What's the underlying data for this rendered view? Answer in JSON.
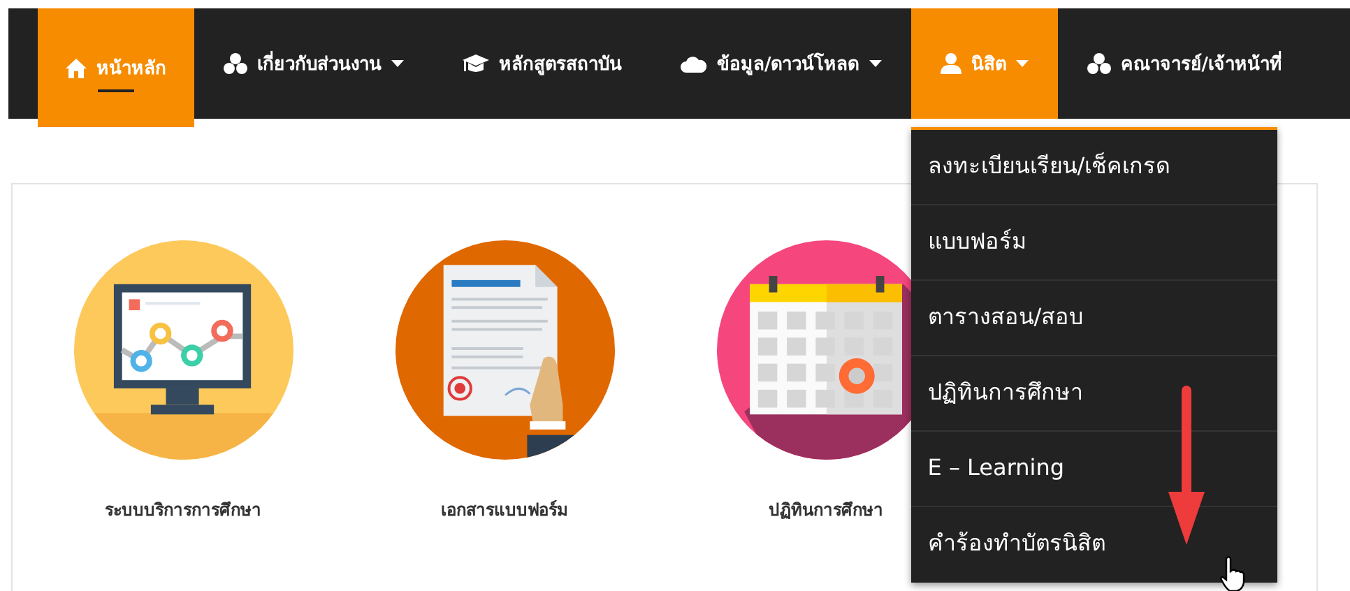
{
  "navbar": {
    "items": [
      {
        "label": "หน้าหลัก",
        "kind": "home",
        "caret": false,
        "selected": true,
        "expanded": false
      },
      {
        "label": "เกี่ยวกับส่วนงาน",
        "kind": "group",
        "caret": true,
        "selected": false,
        "expanded": false
      },
      {
        "label": "หลักสูตรสถาบัน",
        "kind": "cap",
        "caret": false,
        "selected": false,
        "expanded": false
      },
      {
        "label": "ข้อมูล/ดาวน์โหลด",
        "kind": "cloud",
        "caret": true,
        "selected": false,
        "expanded": false
      },
      {
        "label": "นิสิต",
        "kind": "user",
        "caret": true,
        "selected": false,
        "expanded": true
      },
      {
        "label": "คณาจารย์/เจ้าหน้าที่",
        "kind": "group",
        "caret": false,
        "selected": false,
        "expanded": false
      }
    ]
  },
  "dropdown": {
    "items": [
      "ลงทะเบียนเรียน/เช็คเกรด",
      "แบบฟอร์ม",
      "ตารางสอน/สอบ",
      "ปฏิทินการศึกษา",
      "E – Learning",
      "คำร้องทำบัตรนิสิต"
    ]
  },
  "tiles": [
    {
      "label": "ระบบบริการการศึกษา",
      "kind": "monitor"
    },
    {
      "label": "เอกสารแบบฟอร์ม",
      "kind": "document"
    },
    {
      "label": "ปฏิทินการศึกษา",
      "kind": "calendar"
    }
  ]
}
